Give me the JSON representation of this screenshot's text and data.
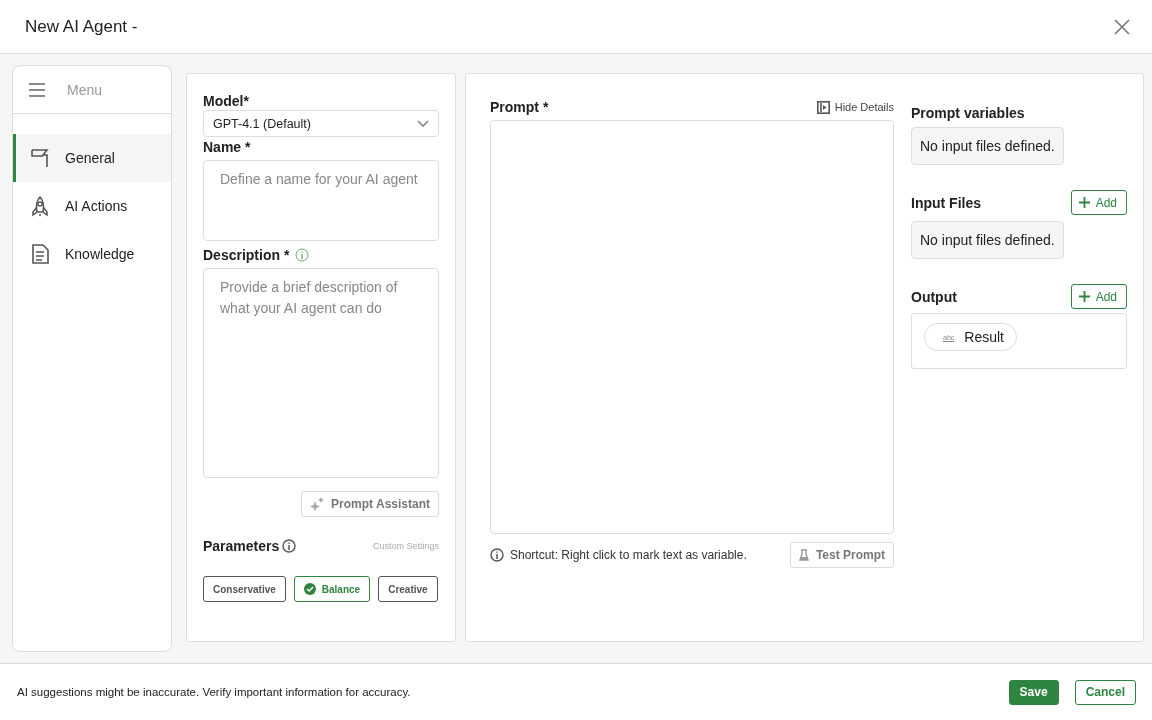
{
  "window": {
    "title": "New AI Agent -"
  },
  "sidebar": {
    "menu_label": "Menu",
    "items": [
      {
        "label": "General",
        "kind": "flag",
        "selected": true
      },
      {
        "label": "AI Actions",
        "kind": "rocket",
        "selected": false
      },
      {
        "label": "Knowledge",
        "kind": "document",
        "selected": false
      }
    ]
  },
  "general": {
    "model": {
      "label": "Model*",
      "value": "GPT-4.1 (Default)"
    },
    "name": {
      "label": "Name *",
      "placeholder": "Define a name for your AI agent"
    },
    "description": {
      "label": "Description  *",
      "placeholder": "Provide a brief description of what your AI agent can do"
    },
    "prompt_assistant": "Prompt Assistant",
    "parameters": {
      "label": "Parameters",
      "custom_link": "Custom Settings",
      "options": [
        {
          "label": "Conservative",
          "selected": false
        },
        {
          "label": "Balance",
          "selected": true
        },
        {
          "label": "Creative",
          "selected": false
        }
      ]
    }
  },
  "prompt": {
    "label": "Prompt *",
    "hide_details": "Hide Details",
    "shortcut_hint": "Shortcut: Right click to mark text as variable.",
    "test_button": "Test Prompt"
  },
  "side": {
    "prompt_variables": {
      "label": "Prompt variables",
      "empty": "No input files defined."
    },
    "input_files": {
      "label": "Input Files",
      "add": "Add",
      "empty": "No input files defined."
    },
    "output": {
      "label": "Output",
      "add": "Add",
      "items": [
        {
          "type_tag": "abc",
          "label": "Result"
        }
      ]
    }
  },
  "footer": {
    "notice": "AI suggestions might be inaccurate. Verify important information for accuracy.",
    "buttons": [
      {
        "label": "Save",
        "kind": "primary"
      },
      {
        "label": "Cancel",
        "kind": "secondary"
      }
    ]
  }
}
